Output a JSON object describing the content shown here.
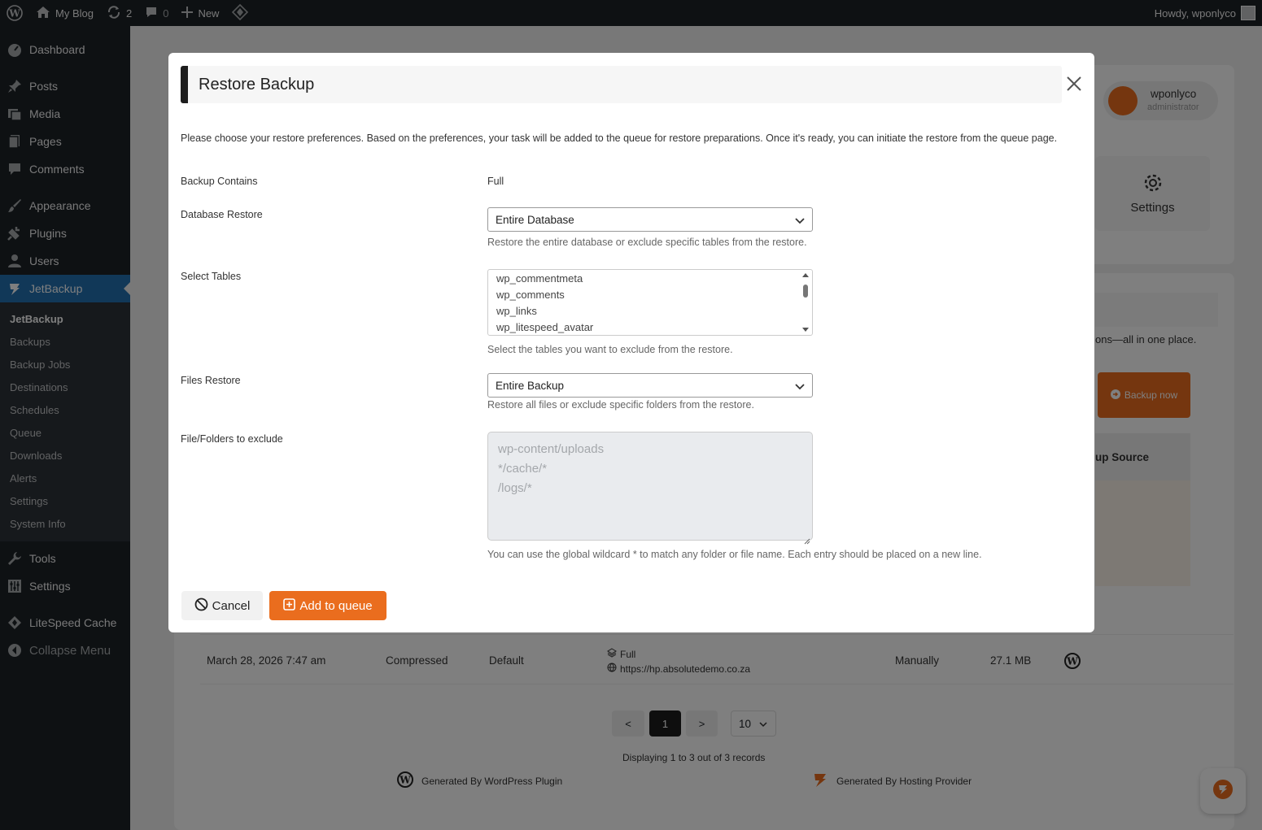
{
  "adminbar": {
    "site_name": "My Blog",
    "updates_count": "2",
    "comments_count": "0",
    "new_label": "New",
    "howdy": "Howdy, wponlyco"
  },
  "sidebar": {
    "items": [
      {
        "label": "Dashboard",
        "icon": "dashboard-icon"
      },
      {
        "label": "Posts",
        "icon": "pin-icon"
      },
      {
        "label": "Media",
        "icon": "media-icon"
      },
      {
        "label": "Pages",
        "icon": "pages-icon"
      },
      {
        "label": "Comments",
        "icon": "comment-icon"
      },
      {
        "label": "Appearance",
        "icon": "brush-icon"
      },
      {
        "label": "Plugins",
        "icon": "plug-icon"
      },
      {
        "label": "Users",
        "icon": "user-icon"
      },
      {
        "label": "JetBackup",
        "icon": "jetbackup-icon"
      }
    ],
    "submenu": [
      "JetBackup",
      "Backups",
      "Backup Jobs",
      "Destinations",
      "Schedules",
      "Queue",
      "Downloads",
      "Alerts",
      "Settings",
      "System Info"
    ],
    "bottom_items": [
      {
        "label": "Tools",
        "icon": "wrench-icon"
      },
      {
        "label": "Settings",
        "icon": "sliders-icon"
      },
      {
        "label": "LiteSpeed Cache",
        "icon": "litespeed-icon"
      },
      {
        "label": "Collapse Menu",
        "icon": "collapse-icon"
      }
    ]
  },
  "background": {
    "user_name": "wponlyco",
    "user_role": "administrator",
    "settings_label": "Settings",
    "tagline_fragment": "ons—all in one place.",
    "backup_now": "Backup now",
    "col_fragment": "up Source",
    "row": {
      "date": "March 28, 2026 7:47 am",
      "type": "Compressed",
      "location": "Default",
      "contains": "Full",
      "source": "https://hp.absolutedemo.co.za",
      "created_by": "Manually",
      "size": "27.1 MB"
    },
    "pagination": {
      "prev": "<",
      "current": "1",
      "next": ">",
      "per_page": "10"
    },
    "displaying": "Displaying 1 to 3 out of 3 records",
    "footer_left": "Generated By WordPress Plugin",
    "footer_right": "Generated By Hosting Provider"
  },
  "modal": {
    "title": "Restore Backup",
    "description": "Please choose your restore preferences. Based on the preferences, your task will be added to the queue for restore preparations. Once it's ready, you can initiate the restore from the queue page.",
    "backup_contains_label": "Backup Contains",
    "backup_contains_value": "Full",
    "db_restore_label": "Database Restore",
    "db_restore_value": "Entire Database",
    "db_restore_help": "Restore the entire database or exclude specific tables from the restore.",
    "select_tables_label": "Select Tables",
    "tables": [
      "wp_commentmeta",
      "wp_comments",
      "wp_links",
      "wp_litespeed_avatar"
    ],
    "select_tables_help": "Select the tables you want to exclude from the restore.",
    "files_restore_label": "Files Restore",
    "files_restore_value": "Entire Backup",
    "files_restore_help": "Restore all files or exclude specific folders from the restore.",
    "exclude_label": "File/Folders to exclude",
    "exclude_placeholder": [
      "wp-content/uploads",
      "*/cache/*",
      "/logs/*"
    ],
    "exclude_help": "You can use the global wildcard * to match any folder or file name. Each entry should be placed on a new line.",
    "cancel_label": "Cancel",
    "add_label": "Add to queue"
  },
  "colors": {
    "accent": "#ea6d1e",
    "admin_bar": "#1d2327",
    "active_menu": "#2271b1"
  }
}
